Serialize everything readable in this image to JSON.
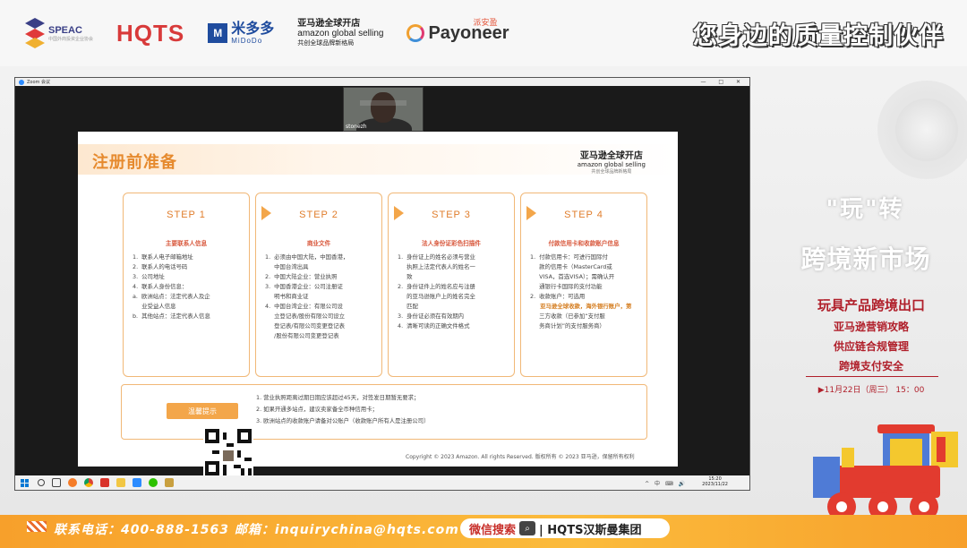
{
  "header": {
    "logos": {
      "speac": "SPEAC",
      "speac_sub": "中国外商投资企业协会",
      "hqts": "HQTS",
      "midodo": "米多多",
      "midodo_sub": "MiDoDo",
      "amazon_cn": "亚马逊全球开店",
      "amazon_en": "amazon global selling",
      "amazon_sub": "共创全球品牌新格局",
      "payoneer": "Payoneer",
      "payoneer_cn": "派安盈"
    },
    "slogan": "您身边的质量控制伙伴"
  },
  "zoom": {
    "title": "Zoom 会议",
    "controls": "— □ ✕",
    "camera_name": "stonezh",
    "slide": {
      "title": "注册前准备",
      "logo_cn": "亚马逊全球开店",
      "logo_en": "amazon global selling",
      "logo_sub": "共创全球品牌新格局",
      "steps": [
        {
          "head": "STEP 1",
          "sub": "主要联系人信息",
          "items": [
            "1.  联系人电子邮箱地址",
            "2.  联系人的电话号码",
            "3.  公司地址",
            "4.  联系人身份信息：",
            "a.  欧洲站点：法定代表人及企",
            "     业受益人信息",
            "b.  其他站点：法定代表人信息"
          ]
        },
        {
          "head": "STEP 2",
          "sub": "商业文件",
          "items": [
            "1.  必须由中国大陆，中国香港，",
            "     中国台湾出具",
            "2.  中国大陆企业：营业执照",
            "3.  中国香港企业：公司注册证",
            "     明书和商业证",
            "4.  中国台湾企业：有限公司设",
            "     立登记表/股份有限公司设立",
            "     登记表/有限公司变更登记表",
            "     /股份有限公司变更登记表"
          ]
        },
        {
          "head": "STEP 3",
          "sub": "法人身份证彩色扫描件",
          "items": [
            "1.  身份证上的姓名必须与营业",
            "     执照上法定代表人的姓名一",
            "     致",
            "2.  身份证件上的姓名应与注册",
            "     的亚马逊账户上的姓名完全",
            "     匹配",
            "3.  身份证必须在有效期内",
            "4.  清晰可读的正确文件格式"
          ]
        },
        {
          "head": "STEP 4",
          "sub": "付款信用卡和收款账户信息",
          "items": [
            "1.  付款信用卡：可进行国际付",
            "     款的信用卡（MasterCard或",
            "     VISA，首选VISA）；需确认开",
            "     通银行卡国际的支付功能",
            "2.  收款账户：可选用",
            "     亚马逊全球收款，海外银行账户，第",
            "     三方收款（已参加“支付服",
            "     务商计划”的支付服务商）"
          ]
        }
      ],
      "tips_label": "温馨提示",
      "tips": [
        "1.  营业执照距离过期日期应该超过45天，对签发日期暂无要求；",
        "2.  如果开通多站点，建议卖家备全币种信用卡；",
        "3.  欧洲站点的收款账户请备对公账户（收款账户所有人是注册公司）"
      ],
      "copyright": "Copyright © 2023 Amazon.  All rights Reserved. 版权所有    ©  2023  亚马逊，保留所有权利"
    },
    "taskbar": {
      "time": "15:20",
      "date": "2023/11/22",
      "tray": "^ 中 ⌨ 🔊"
    }
  },
  "right_panel": {
    "wan": "\"玩\"转",
    "kuajing": "跨境新市场",
    "heading": "玩具产品跨境出口",
    "lines": [
      "亚马逊营销攻略",
      "供应链合规管理",
      "跨境支付安全"
    ],
    "time": "▶11月22日（周三） 15：00"
  },
  "banner": {
    "contact": "联系电话：400-888-1563   邮箱：inquirychina@hqts.com",
    "wechat": "微信搜索",
    "group": "| HQTS汉斯曼集团"
  }
}
